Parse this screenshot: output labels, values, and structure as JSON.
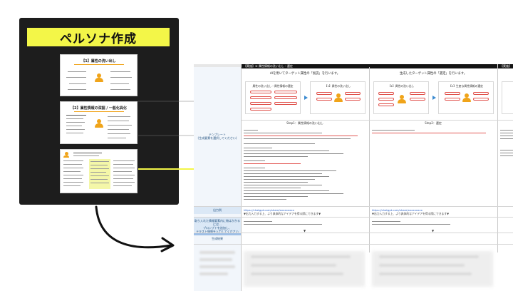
{
  "panel": {
    "title": "ペルソナ作成",
    "slides": [
      {
        "heading": "【1】属性の洗い出し"
      },
      {
        "heading": "【2】属性情報の深掘 / 一般化具化"
      },
      {
        "heading": ""
      }
    ]
  },
  "sheet": {
    "header_left": "【実施】① 属性情報の洗い出し・選定",
    "header_right": "【実施】",
    "section_titles": [
      "AIを用いてターゲット属性の「仮説」を行います。",
      "生成したターゲット属性の「選定」を行います。"
    ],
    "flow_labels": {
      "a1": "属性の洗い出し・属性情報の選定",
      "a2": "【1】属性の洗い出し",
      "b1": "【1】属性の洗い出し",
      "b2": "【2】生産な属性情報の選定"
    },
    "steps": [
      "Step1：属性情報の洗い出し",
      "Step2：選定"
    ],
    "left_labels": {
      "template": "テンプレート",
      "template_sub": "(生成要素を選択してください)",
      "output": "出力例",
      "instruct": "取り入れた情報要素内に物はかかるには...",
      "instruct2": "プロンプトを追加し、",
      "instruct3": "テキスト情報を入力してください",
      "result": "生成結果"
    },
    "links": [
      "https://chatgpt.com/share/xxxxxxxxx",
      "https://chatgpt.com/share/xxxxxxxxx"
    ],
    "notes": [
      "▼出力入力する上、より具体的なアイデアを得る際にできます▼",
      "▼出力入力する上、より具体的なアイデアを得る際にできます▼"
    ],
    "follow": [
      "▼",
      "▼"
    ]
  },
  "colors": {
    "panel_bg": "#1d1d1d",
    "title_yellow": "#f3f648",
    "accent_orange": "#f0a41a",
    "link_blue": "#2a62c8",
    "band_blue": "#9fbfe6",
    "arrow": "#111111"
  }
}
